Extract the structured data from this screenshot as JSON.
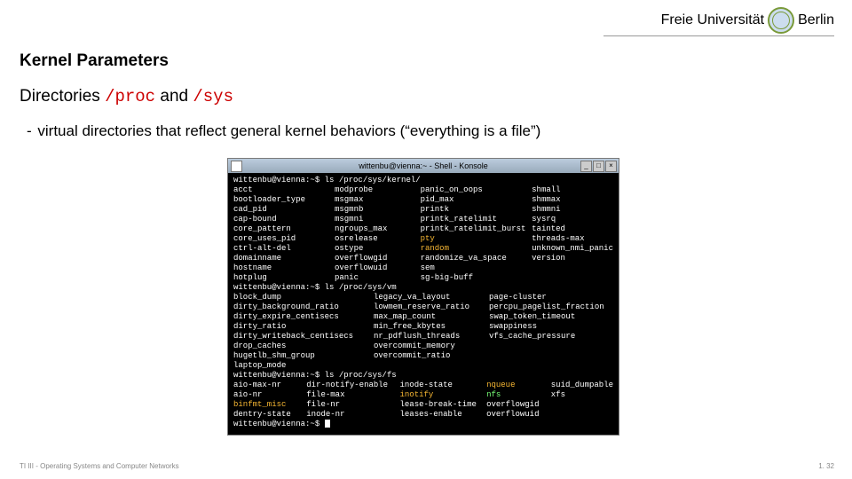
{
  "logo": {
    "text_left": "Freie Universität",
    "text_right": "Berlin"
  },
  "slide": {
    "title": "Kernel Parameters",
    "sub_prefix": "Directories ",
    "sub_code1": "/proc",
    "sub_mid": " and ",
    "sub_code2": "/sys",
    "bullet": "virtual directories that reflect general kernel behaviors (“everything is a file”)"
  },
  "terminal": {
    "titlebar": "wittenbu@vienna:~ - Shell - Konsole",
    "win_min": "_",
    "win_max": "□",
    "win_close": "×",
    "prompt": "wittenbu@vienna:~$",
    "cmd1": "ls /proc/sys/kernel/",
    "ls1": {
      "c1": "acct\nbootloader_type\ncad_pid\ncap-bound\ncore_pattern\ncore_uses_pid\nctrl-alt-del\ndomainname\nhostname\nhotplug",
      "c2": "modprobe\nmsgmax\nmsgmnb\nmsgmni\nngroups_max\nosrelease\nostype\noverflowgid\noverflowuid\npanic",
      "c3_plain_top": "panic_on_oops\npid_max\nprintk\nprintk_ratelimit\nprintk_ratelimit_burst",
      "c3_hl1": "pty",
      "c3_hl2": "random",
      "c3_plain_bot": "randomize_va_space\nsem\nsg-big-buff",
      "c4": "shmall\nshmmax\nshmmni\nsysrq\ntainted\nthreads-max\nunknown_nmi_panic\nversion"
    },
    "cmd2": "ls /proc/sys/vm",
    "ls2": {
      "c1": "block_dump\ndirty_background_ratio\ndirty_expire_centisecs\ndirty_ratio\ndirty_writeback_centisecs\ndrop_caches\nhugetlb_shm_group\nlaptop_mode",
      "c2": "legacy_va_layout\nlowmem_reserve_ratio\nmax_map_count\nmin_free_kbytes\nnr_pdflush_threads\novercommit_memory\novercommit_ratio",
      "c3": "page-cluster\npercpu_pagelist_fraction\nswap_token_timeout\nswappiness\nvfs_cache_pressure"
    },
    "cmd3": "ls /proc/sys/fs",
    "ls3": {
      "c1_plain": "aio-max-nr\naio-nr",
      "c1_hl": "binfmt_misc",
      "c1_plain2": "dentry-state",
      "c2": "dir-notify-enable\nfile-max\nfile-nr\ninode-nr",
      "c3_plain": "inode-state",
      "c3_hl": "inotify",
      "c3_plain2": "lease-break-time\nleases-enable",
      "c4_hl1": "nqueue",
      "c4_hl2": "nfs",
      "c4_plain": "overflowgid\noverflowuid",
      "c5": "suid_dumpable\nxfs"
    }
  },
  "footer": {
    "left": "TI III - Operating Systems and Computer Networks",
    "right": "1. 32"
  }
}
